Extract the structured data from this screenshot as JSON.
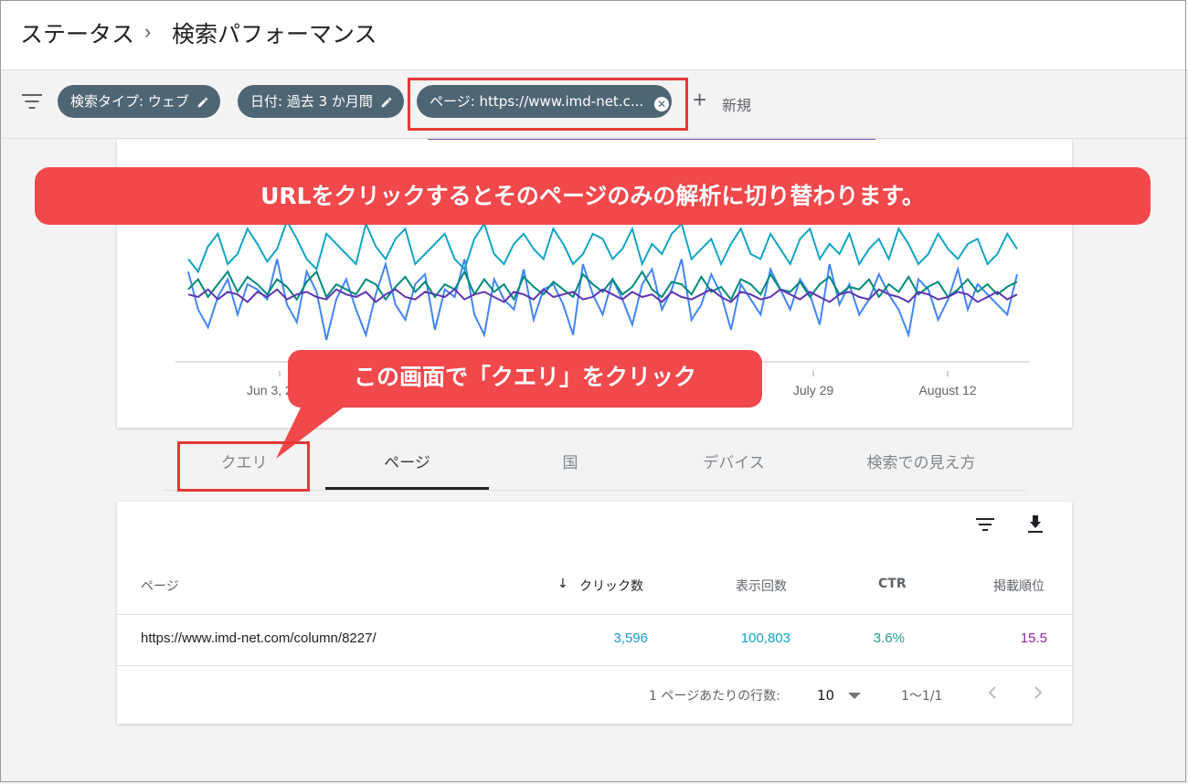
{
  "header": {
    "breadcrumb_root": "ステータス",
    "breadcrumb_separator": "›",
    "breadcrumb_current": "検索パフォーマンス"
  },
  "filters": {
    "chips": [
      {
        "label": "検索タイプ: ウェブ",
        "icon": "pencil-icon"
      },
      {
        "label": "日付: 過去 3 か月間",
        "icon": "pencil-icon"
      },
      {
        "label": "ページ: https://www.imd-net.c...",
        "icon": "close-circle-icon"
      }
    ],
    "add_icon": "+",
    "add_label": "新規"
  },
  "annotations": {
    "callout_top": "URLをクリックするとそのページのみの解析に切り替わります。",
    "callout_bottom": "この画面で「クエリ」をクリック",
    "highlight_color": "#e53935",
    "callout_color": "#f0484b"
  },
  "chart_data": {
    "type": "line",
    "x_tick_labels": [
      "Jun 3, 2",
      "July 29",
      "August 12"
    ],
    "series": [
      {
        "color": "#4285f4",
        "values": [
          55,
          40,
          33,
          45,
          52,
          38,
          50,
          48,
          44,
          60,
          42,
          35,
          55,
          47,
          28,
          44,
          52,
          40,
          30,
          46,
          58,
          42,
          36,
          50,
          54,
          32,
          48,
          45,
          60,
          38,
          30,
          52,
          44,
          40,
          56,
          36,
          48,
          50,
          42,
          30,
          58,
          46,
          38,
          52,
          44,
          34,
          50,
          56,
          40,
          48,
          60,
          36,
          42,
          54,
          46,
          32,
          50,
          44,
          38,
          56,
          48,
          40,
          52,
          46,
          34,
          58,
          42,
          50,
          38,
          44,
          54,
          46,
          40,
          30,
          52,
          48,
          36,
          44,
          56,
          40,
          50,
          46,
          42,
          38,
          54
        ]
      },
      {
        "color": "#00897b",
        "values": [
          48,
          52,
          45,
          50,
          55,
          47,
          53,
          50,
          46,
          52,
          49,
          44,
          51,
          55,
          45,
          50,
          48,
          46,
          52,
          50,
          44,
          49,
          53,
          47,
          51,
          45,
          50,
          48,
          55,
          46,
          52,
          47,
          50,
          44,
          53,
          49,
          46,
          51,
          48,
          45,
          54,
          50,
          47,
          52,
          46,
          49,
          55,
          48,
          45,
          51,
          50,
          46,
          53,
          47,
          49,
          44,
          52,
          50,
          46,
          54,
          48,
          47,
          51,
          45,
          50,
          53,
          46,
          49,
          48,
          52,
          45,
          50,
          47,
          53,
          46,
          49,
          51,
          45,
          48,
          52,
          47,
          50,
          46,
          49,
          51
        ]
      },
      {
        "color": "#5e35b1",
        "values": [
          46,
          45,
          48,
          44,
          47,
          46,
          43,
          47,
          45,
          48,
          44,
          46,
          47,
          45,
          44,
          48,
          46,
          45,
          47,
          43,
          46,
          48,
          45,
          44,
          47,
          46,
          45,
          48,
          44,
          46,
          47,
          45,
          43,
          47,
          46,
          44,
          48,
          45,
          46,
          47,
          44,
          45,
          48,
          46,
          44,
          47,
          45,
          46,
          43,
          47,
          45,
          44,
          46,
          48,
          45,
          43,
          47,
          46,
          44,
          45,
          48,
          46,
          44,
          47,
          45,
          43,
          46,
          47,
          45,
          44,
          48,
          46,
          45,
          43,
          47,
          46,
          44,
          45,
          47,
          46,
          43,
          45,
          47,
          44,
          46
        ]
      },
      {
        "color": "#12a4c4",
        "values": [
          60,
          55,
          65,
          70,
          58,
          62,
          72,
          66,
          59,
          64,
          75,
          68,
          60,
          56,
          70,
          66,
          62,
          58,
          74,
          65,
          60,
          68,
          72,
          58,
          62,
          66,
          70,
          60,
          56,
          68,
          74,
          62,
          58,
          66,
          70,
          64,
          60,
          72,
          66,
          58,
          62,
          70,
          68,
          60,
          64,
          72,
          58,
          66,
          62,
          70,
          74,
          60,
          64,
          68,
          58,
          66,
          72,
          62,
          60,
          70,
          64,
          58,
          68,
          72,
          60,
          66,
          62,
          70,
          58,
          64,
          68,
          60,
          72,
          66,
          58,
          62,
          70,
          64,
          60,
          66,
          68,
          58,
          62,
          70,
          64
        ]
      }
    ]
  },
  "tabs": [
    {
      "label": "クエリ",
      "active": false
    },
    {
      "label": "ページ",
      "active": true
    },
    {
      "label": "国",
      "active": false
    },
    {
      "label": "デバイス",
      "active": false
    },
    {
      "label": "検索での見え方",
      "active": false
    }
  ],
  "table": {
    "toolbar_icons": [
      "filter-icon",
      "download-icon"
    ],
    "columns": {
      "page": "ページ",
      "clicks": "クリック数",
      "impressions": "表示回数",
      "ctr": "CTR",
      "position": "掲載順位"
    },
    "sort_indicator": "↓",
    "rows": [
      {
        "page": "https://www.imd-net.com/column/8227/",
        "clicks": "3,596",
        "impressions": "100,803",
        "ctr": "3.6%",
        "position": "15.5"
      }
    ],
    "colors": {
      "clicks": "#1a9ad6",
      "impressions": "#12a4c4",
      "ctr": "#1e9e8e",
      "position": "#8e24aa"
    },
    "pagination": {
      "rows_per_page_label": "1 ページあたりの行数:",
      "rows_per_page_value": "10",
      "range": "1〜1/1"
    }
  }
}
